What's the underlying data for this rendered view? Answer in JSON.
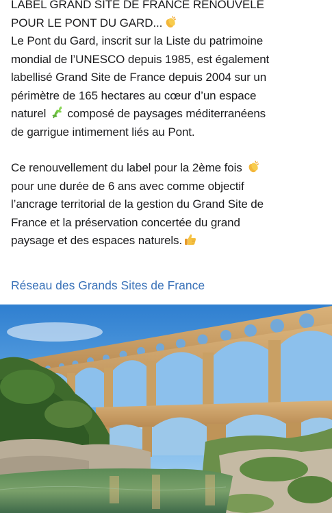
{
  "post": {
    "paragraph1": {
      "line1": "LABEL GRAND SITE DE FRANCE RENOUVELÉ",
      "line2": "POUR LE PONT DU GARD...",
      "line3": "Le Pont du Gard, inscrit sur la Liste du patrimoine",
      "line4": "mondial de l’UNESCO depuis 1985, est également",
      "line5": "labellisé Grand Site de France depuis 2004 sur un",
      "line6": "périmètre de 165 hectares au cœur d’un espace",
      "line7a": "naturel",
      "line7b": "composé de paysages méditerranéens",
      "line8": "de garrigue intimement liés au Pont."
    },
    "paragraph2": {
      "line1": "Ce renouvellement du label pour la 2ème fois",
      "line2": "pour une durée de 6 ans avec comme objectif",
      "line3": "l’ancrage territorial de la gestion du Grand Site de",
      "line4": "France et la préservation concertée du grand",
      "line5": "paysage et des espaces naturels."
    },
    "link_text": "Réseau des Grands Sites de France",
    "link_color": "#3b73b9",
    "icons": [
      "clapping-hands-icon",
      "herb-icon",
      "clapping-hands-icon",
      "thumbs-up-icon"
    ]
  }
}
